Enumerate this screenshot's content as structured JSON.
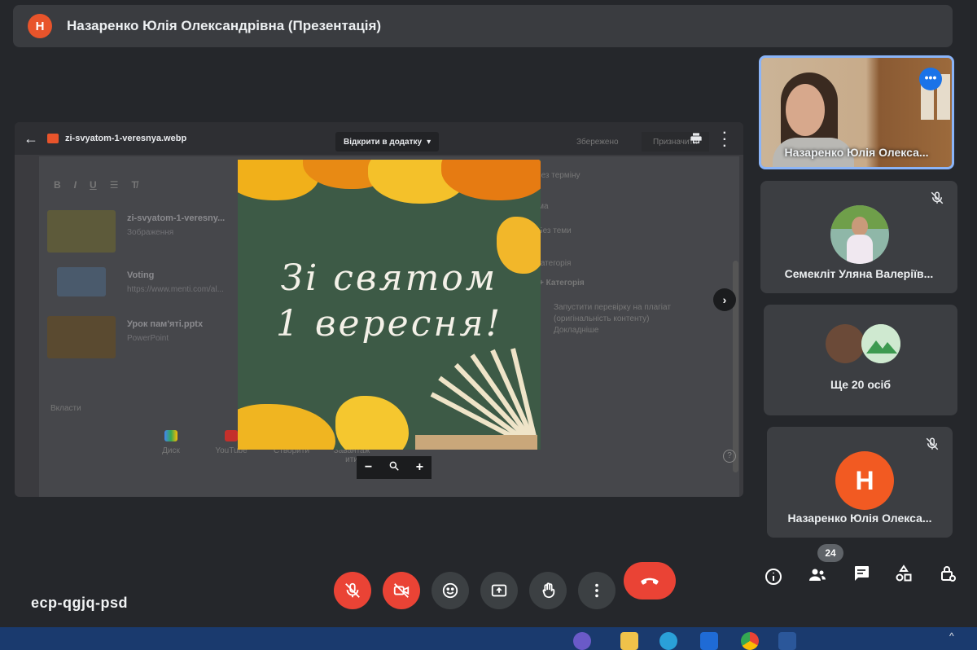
{
  "header": {
    "avatar_letter": "Н",
    "title": "Назаренко Юлія Олександрівна (Презентація)"
  },
  "viewer": {
    "file_name": "zi-svyatom-1-veresnya.webp",
    "open_in_app": "Відкрити в додатку",
    "faded_left": "Збережено",
    "faded_right": "Призначити"
  },
  "doc": {
    "attachments": [
      {
        "title": "zi-svyatom-1-veresny...",
        "subtitle": "Зображення"
      },
      {
        "title": "Voting",
        "subtitle": "https://www.menti.com/al..."
      },
      {
        "title": "Урок пам'яті.pptx",
        "subtitle": "PowerPoint"
      }
    ],
    "add_label": "Вкласти",
    "add_items": [
      "Диск",
      "YouTube",
      "Створити",
      "Завантаж ити"
    ],
    "form": {
      "due": "Без терміну",
      "topic_label": "Тема",
      "topic": "Без теми",
      "category_label": "Категорія",
      "add_category": "+ Категорія",
      "plagiarism_1": "Запустити перевірку на плагіат",
      "plagiarism_2": "(оригінальність контенту)",
      "more": "Докладніше"
    }
  },
  "slide": {
    "line1": "Зі святом",
    "line2": "1 вересня!"
  },
  "participants": [
    {
      "name": "Назаренко Юлія Олекса..."
    },
    {
      "name": "Семекліт Уляна Валеріїв..."
    },
    {
      "name": "Ще 20 осіб"
    },
    {
      "name": "Назаренко Юлія Олекса...",
      "avatar_letter": "Н"
    }
  ],
  "meeting_code": "ecp-qgjq-psd",
  "people_count": "24",
  "colors": {
    "accent": "#1a73e8",
    "danger": "#ea4335",
    "avatar": "#f25a22"
  },
  "icons": {
    "mic": "mic-off-icon",
    "camera": "camera-off-icon",
    "emoji": "emoji-icon",
    "present": "present-screen-icon",
    "hand": "raise-hand-icon",
    "more": "more-vert-icon",
    "hangup": "hangup-icon",
    "info": "info-icon",
    "people": "people-icon",
    "chat": "chat-icon",
    "activities": "activities-icon",
    "lock": "host-controls-icon"
  }
}
